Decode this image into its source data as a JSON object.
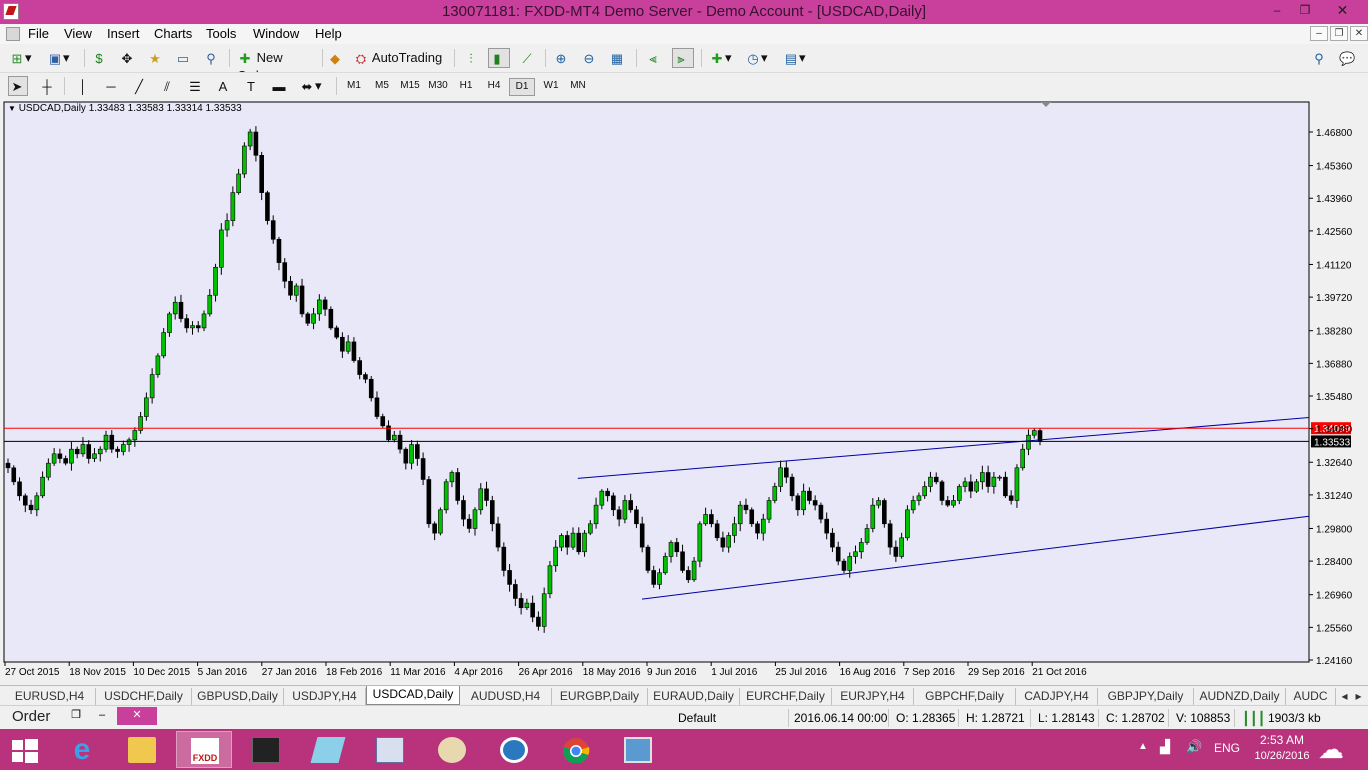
{
  "window": {
    "title": "130071181: FXDD-MT4 Demo Server - Demo Account - [USDCAD,Daily]",
    "minimize": "‒",
    "maximize": "❐",
    "close": "✕"
  },
  "menu": {
    "items": [
      "File",
      "View",
      "Insert",
      "Charts",
      "Tools",
      "Window",
      "Help"
    ]
  },
  "toolbar": {
    "new_order": "New Order",
    "autotrading": "AutoTrading",
    "timeframes": [
      "M1",
      "M5",
      "M15",
      "M30",
      "H1",
      "H4",
      "D1",
      "W1",
      "MN"
    ],
    "active_timeframe": "D1"
  },
  "chart_header": "USDCAD,Daily  1.33483 1.33583 1.33314 1.33533",
  "chart_data": {
    "type": "candlestick",
    "symbol": "USDCAD",
    "period": "Daily",
    "open": 1.33483,
    "high": 1.33583,
    "low": 1.33314,
    "close": 1.33533,
    "y_ticks": [
      "1.46800",
      "1.45360",
      "1.43960",
      "1.42560",
      "1.41120",
      "1.39720",
      "1.38280",
      "1.36880",
      "1.35480",
      "1.34080",
      "1.32640",
      "1.31240",
      "1.29800",
      "1.28400",
      "1.26960",
      "1.25560",
      "1.24160"
    ],
    "ylim": [
      1.2416,
      1.468
    ],
    "x_labels": [
      "27 Oct 2015",
      "18 Nov 2015",
      "10 Dec 2015",
      "5 Jan 2016",
      "27 Jan 2016",
      "18 Feb 2016",
      "11 Mar 2016",
      "4 Apr 2016",
      "26 Apr 2016",
      "18 May 2016",
      "9 Jun 2016",
      "1 Jul 2016",
      "25 Jul 2016",
      "16 Aug 2016",
      "7 Sep 2016",
      "29 Sep 2016",
      "21 Oct 2016"
    ],
    "price_lines": [
      {
        "label": "1.34099",
        "value": 1.34099,
        "color": "#ff0000"
      },
      {
        "label": "1.33533",
        "value": 1.33533,
        "color": "#000000"
      }
    ],
    "trendlines": [
      {
        "from": [
          "9 Jun 2016",
          1.2677
        ],
        "to": [
          "21 Oct 2016",
          1.2885
        ]
      },
      {
        "from": [
          "18 May 2016",
          1.3195
        ],
        "to": [
          "21 Oct 2016",
          1.3357
        ]
      }
    ],
    "colors": {
      "bull": "#00c000",
      "bear": "#000000",
      "background": "#e8e8f8",
      "trendline": "#0000a0"
    },
    "closes": [
      1.324,
      1.318,
      1.312,
      1.308,
      1.306,
      1.312,
      1.32,
      1.326,
      1.33,
      1.328,
      1.326,
      1.332,
      1.33,
      1.334,
      1.328,
      1.33,
      1.332,
      1.338,
      1.332,
      1.331,
      1.334,
      1.336,
      1.34,
      1.346,
      1.354,
      1.364,
      1.372,
      1.382,
      1.39,
      1.395,
      1.388,
      1.384,
      1.385,
      1.384,
      1.39,
      1.398,
      1.41,
      1.426,
      1.43,
      1.442,
      1.45,
      1.462,
      1.468,
      1.458,
      1.442,
      1.43,
      1.422,
      1.412,
      1.404,
      1.398,
      1.402,
      1.39,
      1.386,
      1.39,
      1.396,
      1.392,
      1.384,
      1.38,
      1.374,
      1.378,
      1.37,
      1.364,
      1.362,
      1.354,
      1.346,
      1.342,
      1.336,
      1.338,
      1.332,
      1.326,
      1.334,
      1.328,
      1.319,
      1.3,
      1.296,
      1.306,
      1.318,
      1.322,
      1.31,
      1.302,
      1.298,
      1.306,
      1.315,
      1.31,
      1.3,
      1.29,
      1.28,
      1.274,
      1.268,
      1.264,
      1.266,
      1.26,
      1.256,
      1.27,
      1.282,
      1.29,
      1.295,
      1.29,
      1.296,
      1.288,
      1.296,
      1.3,
      1.308,
      1.314,
      1.312,
      1.306,
      1.302,
      1.31,
      1.306,
      1.3,
      1.29,
      1.28,
      1.274,
      1.279,
      1.286,
      1.292,
      1.288,
      1.28,
      1.276,
      1.284,
      1.3,
      1.304,
      1.3,
      1.294,
      1.29,
      1.295,
      1.3,
      1.308,
      1.306,
      1.3,
      1.296,
      1.302,
      1.31,
      1.316,
      1.324,
      1.32,
      1.312,
      1.306,
      1.314,
      1.31,
      1.308,
      1.302,
      1.296,
      1.29,
      1.284,
      1.28,
      1.286,
      1.288,
      1.292,
      1.298,
      1.308,
      1.31,
      1.3,
      1.29,
      1.286,
      1.294,
      1.306,
      1.31,
      1.312,
      1.316,
      1.32,
      1.318,
      1.31,
      1.308,
      1.31,
      1.316,
      1.318,
      1.314,
      1.318,
      1.322,
      1.316,
      1.32,
      1.32,
      1.312,
      1.31,
      1.324,
      1.332,
      1.338,
      1.34,
      1.3353
    ]
  },
  "tabs": [
    "EURUSD,H4",
    "USDCHF,Daily",
    "GBPUSD,Daily",
    "USDJPY,H4",
    "USDCAD,Daily",
    "AUDUSD,H4",
    "EURGBP,Daily",
    "EURAUD,Daily",
    "EURCHF,Daily",
    "EURJPY,H4",
    "GBPCHF,Daily",
    "CADJPY,H4",
    "GBPJPY,Daily",
    "AUDNZD,Daily",
    "AUDC"
  ],
  "active_tab": "USDCAD,Daily",
  "order_panel": {
    "label": "Order",
    "close": "✕"
  },
  "status": {
    "profile": "Default",
    "datetime": "2016.06.14 00:00",
    "open": "O: 1.28365",
    "high": "H: 1.28721",
    "low": "L: 1.28143",
    "close": "C: 1.28702",
    "volume": "V: 108853",
    "traffic": "1903/3 kb"
  },
  "taskbar": {
    "lang": "ENG",
    "time": "2:53 AM",
    "date": "10/26/2016"
  }
}
